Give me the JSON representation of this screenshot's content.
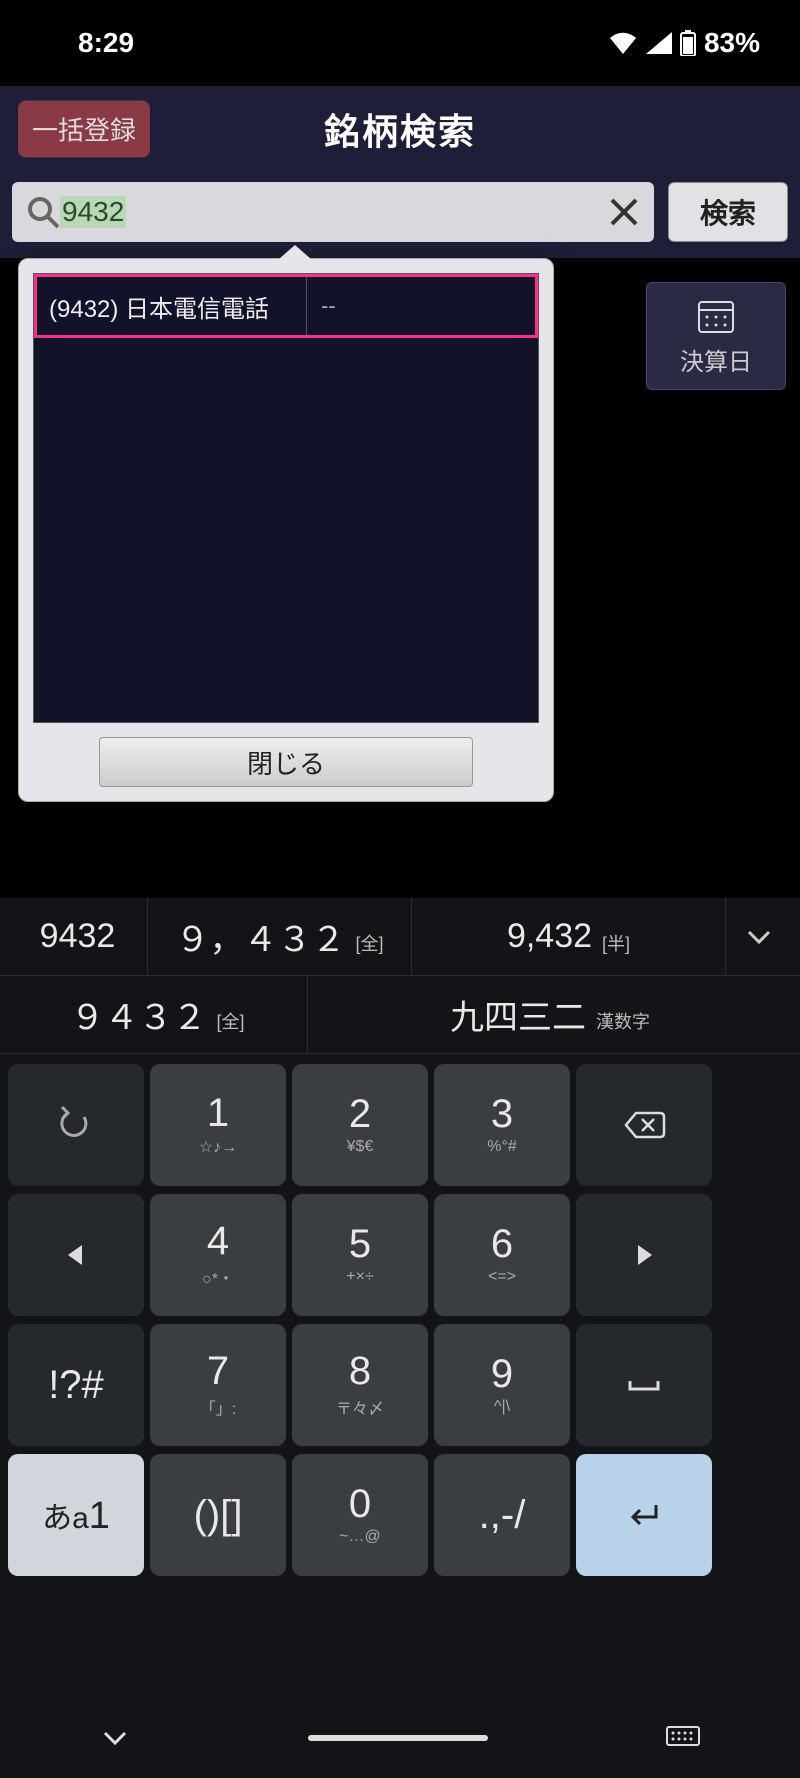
{
  "status": {
    "time": "8:29",
    "battery": "83%"
  },
  "header": {
    "bulk_register": "一括登録",
    "title": "銘柄検索"
  },
  "search": {
    "value": "9432",
    "button": "検索"
  },
  "behind": {
    "calendar_label": "決算日"
  },
  "popup": {
    "result": {
      "main": "(9432) 日本電信電話",
      "sub": "--"
    },
    "close": "閉じる"
  },
  "suggestions": {
    "row1": [
      {
        "text": "9432",
        "tag": ""
      },
      {
        "text": "９，４３２",
        "tag": "[全]"
      },
      {
        "text": "9,432",
        "tag": "[半]"
      }
    ],
    "row2": [
      {
        "text": "９４３２",
        "tag": "[全]"
      },
      {
        "text": "九四三二",
        "tag": "漢数字"
      }
    ]
  },
  "keys": {
    "r1": [
      {
        "type": "undo"
      },
      {
        "big": "1",
        "sm": "☆♪→"
      },
      {
        "big": "2",
        "sm": "¥$€"
      },
      {
        "big": "3",
        "sm": "%°#"
      },
      {
        "type": "backspace"
      }
    ],
    "r2": [
      {
        "type": "left"
      },
      {
        "big": "4",
        "sm": "○*・"
      },
      {
        "big": "5",
        "sm": "+×÷"
      },
      {
        "big": "6",
        "sm": "<=>"
      },
      {
        "type": "right"
      }
    ],
    "r3": [
      {
        "big": "!?#",
        "sm": ""
      },
      {
        "big": "7",
        "sm": "「」:"
      },
      {
        "big": "8",
        "sm": "〒々〆"
      },
      {
        "big": "9",
        "sm": "^|\\"
      },
      {
        "type": "space"
      }
    ],
    "r4": [
      {
        "type": "mode",
        "big": "あa1"
      },
      {
        "big": "()[]",
        "sm": ""
      },
      {
        "big": "0",
        "sm": "~…@"
      },
      {
        "big": ".,-/",
        "sm": ""
      },
      {
        "type": "enter"
      }
    ]
  }
}
